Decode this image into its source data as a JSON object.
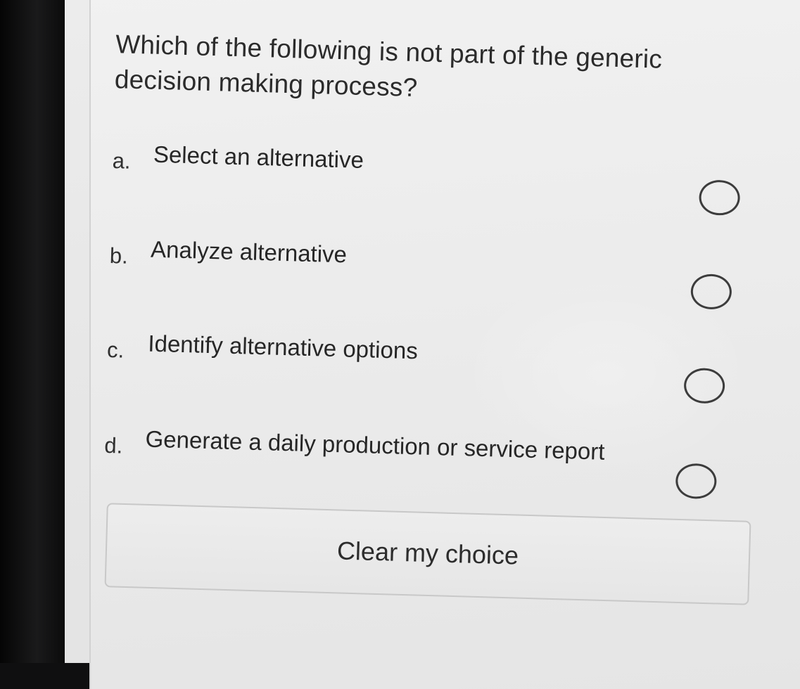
{
  "question": {
    "text": "Which of the following is not part of the generic decision making process?"
  },
  "options": [
    {
      "letter": "a.",
      "text": "Select an alternative",
      "selected": false
    },
    {
      "letter": "b.",
      "text": "Analyze alternative",
      "selected": false
    },
    {
      "letter": "c.",
      "text": "Identify alternative options",
      "selected": false
    },
    {
      "letter": "d.",
      "text": "Generate a daily production or service report",
      "selected": false
    }
  ],
  "clear_button": {
    "label": "Clear my choice"
  },
  "icons": {
    "radio": "radio-button-icon"
  }
}
